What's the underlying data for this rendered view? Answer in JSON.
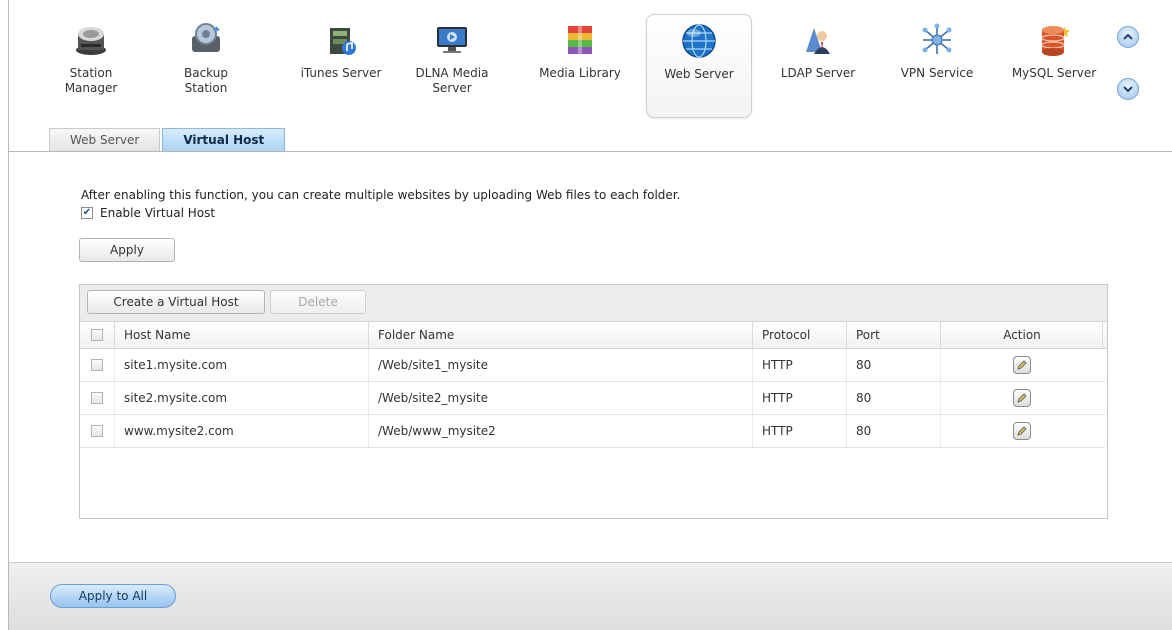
{
  "apps": [
    {
      "label_lines": [
        "Station",
        "Manager"
      ],
      "icon": "station-manager-icon"
    },
    {
      "label_lines": [
        "Backup",
        "Station"
      ],
      "icon": "backup-station-icon"
    },
    {
      "label_lines": [
        "iTunes Server"
      ],
      "icon": "itunes-server-icon"
    },
    {
      "label_lines": [
        "DLNA Media",
        "Server"
      ],
      "icon": "dlna-media-server-icon"
    },
    {
      "label_lines": [
        "Media Library"
      ],
      "icon": "media-library-icon"
    },
    {
      "label_lines": [
        "Web Server"
      ],
      "icon": "web-server-icon",
      "active": true
    },
    {
      "label_lines": [
        "LDAP Server"
      ],
      "icon": "ldap-server-icon"
    },
    {
      "label_lines": [
        "VPN Service"
      ],
      "icon": "vpn-service-icon"
    },
    {
      "label_lines": [
        "MySQL Server"
      ],
      "icon": "mysql-server-icon"
    }
  ],
  "tabs": [
    {
      "label": "Web Server",
      "active": false
    },
    {
      "label": "Virtual Host",
      "active": true
    }
  ],
  "description": "After enabling this function, you can create multiple websites by uploading Web files to each folder.",
  "enable_virtual_host": {
    "label": "Enable Virtual Host",
    "checked": true
  },
  "apply_label": "Apply",
  "grid": {
    "toolbar": {
      "create_label": "Create a Virtual Host",
      "delete_label": "Delete"
    },
    "columns": [
      "Host Name",
      "Folder Name",
      "Protocol",
      "Port",
      "Action"
    ],
    "rows": [
      {
        "host": "site1.mysite.com",
        "folder": "/Web/site1_mysite",
        "protocol": "HTTP",
        "port": "80"
      },
      {
        "host": "site2.mysite.com",
        "folder": "/Web/site2_mysite",
        "protocol": "HTTP",
        "port": "80"
      },
      {
        "host": "www.mysite2.com",
        "folder": "/Web/www_mysite2",
        "protocol": "HTTP",
        "port": "80"
      }
    ]
  },
  "footer": {
    "apply_all_label": "Apply to All"
  },
  "colors": {
    "accent": "#a9d2f3",
    "button_blue": "#96c3ee"
  }
}
